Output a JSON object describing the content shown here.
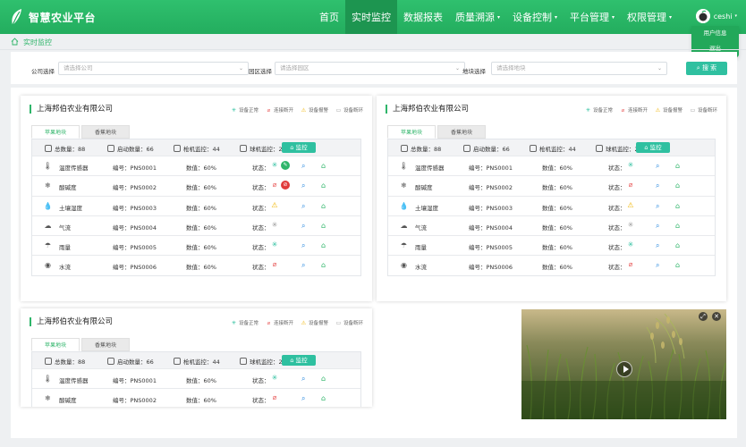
{
  "app": {
    "title": "智慧农业平台"
  },
  "nav": [
    {
      "label": "首页",
      "active": false,
      "caret": false
    },
    {
      "label": "实时监控",
      "active": true,
      "caret": false
    },
    {
      "label": "数据报表",
      "active": false,
      "caret": false
    },
    {
      "label": "质量溯源",
      "active": false,
      "caret": true
    },
    {
      "label": "设备控制",
      "active": false,
      "caret": true
    },
    {
      "label": "平台管理",
      "active": false,
      "caret": true
    },
    {
      "label": "权限管理",
      "active": false,
      "caret": true
    }
  ],
  "user": {
    "name": "ceshi",
    "menu": [
      "用户信息",
      "退出"
    ]
  },
  "breadcrumb": {
    "label": "实时监控"
  },
  "filters": {
    "company": {
      "label": "公司选择",
      "placeholder": "请选择公司"
    },
    "park": {
      "label": "园区选择",
      "placeholder": "请选择园区"
    },
    "plot": {
      "label": "地块选择",
      "placeholder": "请选择地块"
    },
    "search_label": "搜 索"
  },
  "legend": [
    "设备正常",
    "连接断开",
    "设备报警",
    "设备断环"
  ],
  "colors": {
    "accent": "#2fb56a",
    "normal": "#2fc0a0",
    "disconnect": "#e85a5a",
    "alarm": "#f0b400",
    "offline": "#999999"
  },
  "cards": [
    {
      "company": "上海邦伯农业有限公司",
      "tabs": [
        "苹果地块",
        "香蕉地块"
      ],
      "summary": {
        "total": "总数量：88",
        "started": "启动数量：66",
        "gun": "枪机监控：44",
        "ball": "球机监控：22",
        "monitor": "监控"
      },
      "rows": [
        {
          "name": "温度传感器",
          "code": "编号：PNS0001",
          "value": "数值：60%",
          "status_label": "状态：",
          "status": "normal",
          "icon": "thermometer-icon",
          "glyph": "🌡",
          "extra": "green"
        },
        {
          "name": "酸碱度",
          "code": "编号：PNS0002",
          "value": "数值：60%",
          "status_label": "状态：",
          "status": "disconnect",
          "icon": "ph-icon",
          "glyph": "❄",
          "extra": "red"
        },
        {
          "name": "土壤湿度",
          "code": "编号：PNS0003",
          "value": "数值：60%",
          "status_label": "状态：",
          "status": "alarm",
          "icon": "humidity-icon",
          "glyph": "💧",
          "extra": ""
        },
        {
          "name": "气流",
          "code": "编号：PNS0004",
          "value": "数值：60%",
          "status_label": "状态：",
          "status": "offline",
          "icon": "cloud-icon",
          "glyph": "☁",
          "extra": ""
        },
        {
          "name": "雨量",
          "code": "编号：PNS0005",
          "value": "数值：60%",
          "status_label": "状态：",
          "status": "normal",
          "icon": "rain-icon",
          "glyph": "☂",
          "extra": ""
        },
        {
          "name": "水流",
          "code": "编号：PNS0006",
          "value": "数值：60%",
          "status_label": "状态：",
          "status": "disconnect",
          "icon": "water-icon",
          "glyph": "◉",
          "extra": ""
        }
      ]
    },
    {
      "company": "上海邦伯农业有限公司",
      "tabs": [
        "苹果地块",
        "香蕉地块"
      ],
      "summary": {
        "total": "总数量：88",
        "started": "启动数量：66",
        "gun": "枪机监控：44",
        "ball": "球机监控：22",
        "monitor": "监控"
      },
      "rows": [
        {
          "name": "温度传感器",
          "code": "编号：PNS0001",
          "value": "数值：60%",
          "status_label": "状态：",
          "status": "normal",
          "icon": "thermometer-icon",
          "glyph": "🌡",
          "extra": ""
        },
        {
          "name": "酸碱度",
          "code": "编号：PNS0002",
          "value": "数值：60%",
          "status_label": "状态：",
          "status": "disconnect",
          "icon": "ph-icon",
          "glyph": "❄",
          "extra": ""
        },
        {
          "name": "土壤湿度",
          "code": "编号：PNS0003",
          "value": "数值：60%",
          "status_label": "状态：",
          "status": "alarm",
          "icon": "humidity-icon",
          "glyph": "💧",
          "extra": ""
        },
        {
          "name": "气流",
          "code": "编号：PNS0004",
          "value": "数值：60%",
          "status_label": "状态：",
          "status": "offline",
          "icon": "cloud-icon",
          "glyph": "☁",
          "extra": ""
        },
        {
          "name": "雨量",
          "code": "编号：PNS0005",
          "value": "数值：60%",
          "status_label": "状态：",
          "status": "normal",
          "icon": "rain-icon",
          "glyph": "☂",
          "extra": ""
        },
        {
          "name": "水流",
          "code": "编号：PNS0006",
          "value": "数值：60%",
          "status_label": "状态：",
          "status": "disconnect",
          "icon": "water-icon",
          "glyph": "◉",
          "extra": ""
        }
      ]
    },
    {
      "company": "上海邦伯农业有限公司",
      "tabs": [
        "苹果地块",
        "香蕉地块"
      ],
      "summary": {
        "total": "总数量：88",
        "started": "启动数量：66",
        "gun": "枪机监控：44",
        "ball": "球机监控：22",
        "monitor": "监控"
      },
      "rows": [
        {
          "name": "温度传感器",
          "code": "编号：PNS0001",
          "value": "数值：60%",
          "status_label": "状态：",
          "status": "normal",
          "icon": "thermometer-icon",
          "glyph": "🌡",
          "extra": ""
        },
        {
          "name": "酸碱度",
          "code": "编号：PNS0002",
          "value": "数值：60%",
          "status_label": "状态：",
          "status": "disconnect",
          "icon": "ph-icon",
          "glyph": "❄",
          "extra": ""
        }
      ]
    }
  ]
}
